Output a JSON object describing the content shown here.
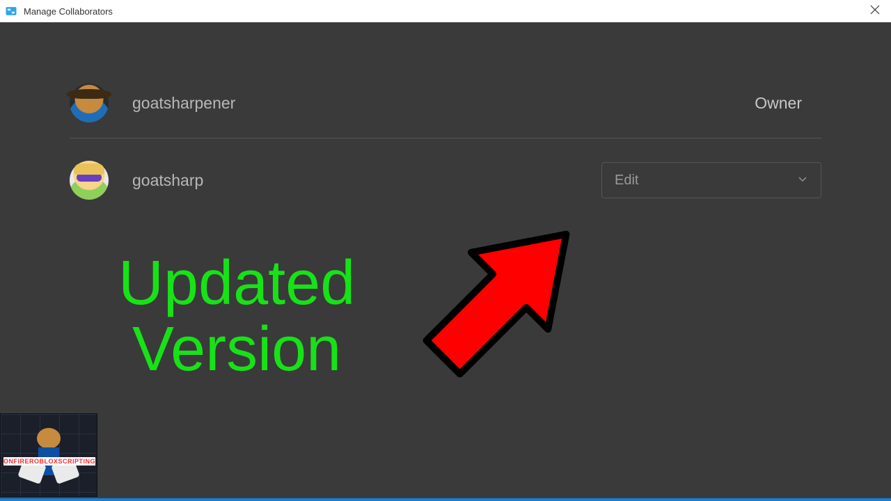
{
  "window": {
    "title": "Manage Collaborators"
  },
  "collaborators": [
    {
      "username": "goatsharpener",
      "role": "Owner"
    },
    {
      "username": "goatsharp",
      "permission": "Edit"
    }
  ],
  "annotation": {
    "text_line1": "Updated",
    "text_line2": "Version",
    "color": "#17e217",
    "arrow_color": "#ff0000"
  },
  "badge": {
    "banner_text": "ONFIREROBLOXSCRIPTING"
  }
}
